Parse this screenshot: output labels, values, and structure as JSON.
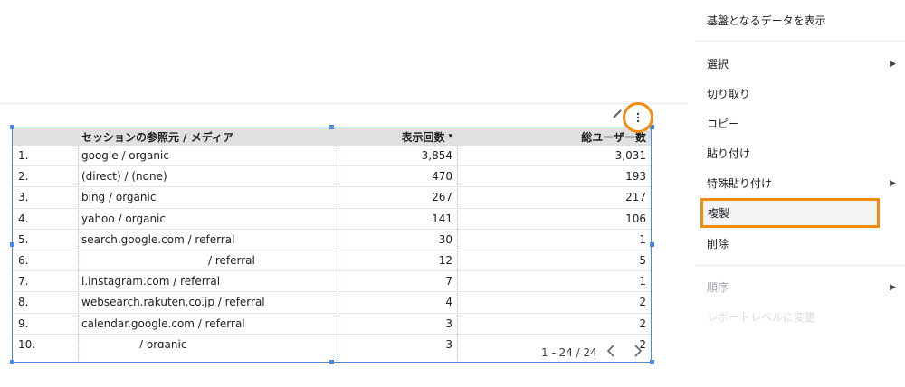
{
  "table": {
    "headers": {
      "source": "セッションの参照元 / メディア",
      "impressions": "表示回数",
      "users": "総ユーザー数"
    },
    "rows": [
      {
        "num": "1.",
        "source": "google / organic",
        "impressions": "3,854",
        "users": "3,031"
      },
      {
        "num": "2.",
        "source": "(direct) / (none)",
        "impressions": "470",
        "users": "193"
      },
      {
        "num": "3.",
        "source": "bing / organic",
        "impressions": "267",
        "users": "217"
      },
      {
        "num": "4.",
        "source": "yahoo / organic",
        "impressions": "141",
        "users": "106"
      },
      {
        "num": "5.",
        "source": "search.google.com / referral",
        "impressions": "30",
        "users": "1"
      },
      {
        "num": "6.",
        "source": "/ referral",
        "impressions": "12",
        "users": "5"
      },
      {
        "num": "7.",
        "source": "l.instagram.com / referral",
        "impressions": "7",
        "users": "1"
      },
      {
        "num": "8.",
        "source": "websearch.rakuten.co.jp / referral",
        "impressions": "4",
        "users": "2"
      },
      {
        "num": "9.",
        "source": "calendar.google.com / referral",
        "impressions": "3",
        "users": "2"
      },
      {
        "num": "10.",
        "source": "/ organic",
        "impressions": "3",
        "users": "2"
      }
    ],
    "sort_indicator": "▾",
    "pagination": "1 - 24 / 24",
    "prev_icon": "chevron-left-icon",
    "next_icon": "chevron-right-icon"
  },
  "chart_actions": {
    "edit_icon": "pencil-icon",
    "more_icon": "more-vert-icon",
    "highlight_color": "#f28b12"
  },
  "menu": {
    "items": [
      {
        "label": "基盤となるデータを表示",
        "submenu": false,
        "disabled": false
      },
      {
        "label": "選択",
        "submenu": true,
        "disabled": false
      },
      {
        "label": "切り取り",
        "submenu": false,
        "disabled": false
      },
      {
        "label": "コピー",
        "submenu": false,
        "disabled": false
      },
      {
        "label": "貼り付け",
        "submenu": false,
        "disabled": false
      },
      {
        "label": "特殊貼り付け",
        "submenu": true,
        "disabled": false
      },
      {
        "label": "複製",
        "submenu": false,
        "disabled": false,
        "highlighted": true
      },
      {
        "label": "削除",
        "submenu": false,
        "disabled": false
      },
      {
        "label": "順序",
        "submenu": true,
        "disabled": true
      },
      {
        "label": "レポートレベルに変更",
        "submenu": false,
        "disabled": true
      }
    ]
  }
}
